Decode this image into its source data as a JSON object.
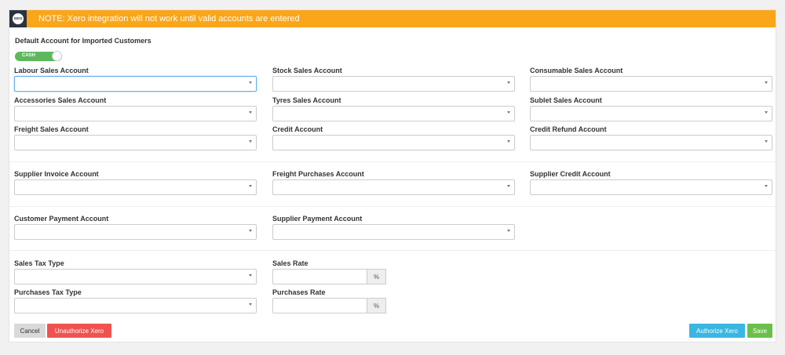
{
  "banner": {
    "logo_text": "xero",
    "message": "NOTE: Xero integration will not work until valid accounts are entered"
  },
  "default_account": {
    "title": "Default Account for Imported Customers",
    "toggle_label": "CASH"
  },
  "fields": {
    "labour_sales": "Labour Sales Account",
    "stock_sales": "Stock Sales Account",
    "consumable_sales": "Consumable Sales Account",
    "accessories_sales": "Accessories Sales Account",
    "tyres_sales": "Tyres Sales Account",
    "sublet_sales": "Sublet Sales Account",
    "freight_sales": "Freight Sales Account",
    "credit": "Credit Account",
    "credit_refund": "Credit Refund Account",
    "supplier_invoice": "Supplier Invoice Account",
    "freight_purchases": "Freight Purchases Account",
    "supplier_credit": "Supplier Credit Account",
    "customer_payment": "Customer Payment Account",
    "supplier_payment": "Supplier Payment Account",
    "sales_tax_type": "Sales Tax Type",
    "sales_rate": "Sales Rate",
    "purchases_tax_type": "Purchases Tax Type",
    "purchases_rate": "Purchases Rate",
    "percent": "%"
  },
  "buttons": {
    "cancel": "Cancel",
    "unauthorize": "Unauthorize Xero",
    "authorize": "Authorize Xero",
    "save": "Save"
  },
  "colors": {
    "banner": "#f9a61a",
    "toggle": "#5cb85c",
    "danger": "#ef5350",
    "info": "#3ab7e0",
    "success": "#6cc04a"
  }
}
